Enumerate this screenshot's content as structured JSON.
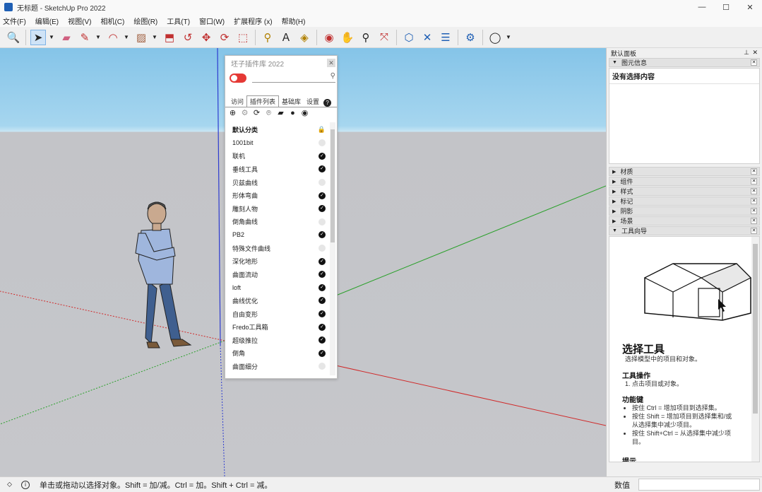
{
  "window": {
    "title": "无标题 - SketchUp Pro 2022",
    "minimize": "—",
    "maximize": "☐",
    "close": "✕"
  },
  "menu": [
    "文件(F)",
    "编辑(E)",
    "视图(V)",
    "相机(C)",
    "绘图(R)",
    "工具(T)",
    "窗口(W)",
    "扩展程序 (x)",
    "帮助(H)"
  ],
  "toolbar_icons": [
    "zoom-extents",
    "select",
    "eraser",
    "pencil-line",
    "arc",
    "paint-bucket",
    "push-pull",
    "follow-me",
    "move",
    "rotate",
    "scale",
    "tape-measure",
    "text",
    "paint",
    "orbit",
    "pan",
    "zoom",
    "zoom-window",
    "warehouse",
    "extension-warehouse",
    "layout",
    "sandbox",
    "account"
  ],
  "plugin_panel": {
    "title": "坯子插件库 2022",
    "search_placeholder": "",
    "tabs": [
      "访问",
      "插件列表",
      "基础库",
      "设置",
      "?"
    ],
    "category": "默认分类",
    "items": [
      {
        "name": "1001bit",
        "enabled": false
      },
      {
        "name": "联机",
        "enabled": true
      },
      {
        "name": "垂线工具",
        "enabled": true
      },
      {
        "name": "贝兹曲线",
        "enabled": false
      },
      {
        "name": "形体弯曲",
        "enabled": true
      },
      {
        "name": "雕刻人物",
        "enabled": true
      },
      {
        "name": "倒角曲线",
        "enabled": false
      },
      {
        "name": "PB2",
        "enabled": true
      },
      {
        "name": "特殊文件曲线",
        "enabled": false
      },
      {
        "name": "深化地形",
        "enabled": true
      },
      {
        "name": "曲面流动",
        "enabled": true
      },
      {
        "name": "loft",
        "enabled": true
      },
      {
        "name": "曲线优化",
        "enabled": true
      },
      {
        "name": "自由变形",
        "enabled": true
      },
      {
        "name": "Fredo工具箱",
        "enabled": true
      },
      {
        "name": "超级推拉",
        "enabled": true
      },
      {
        "name": "倒角",
        "enabled": true
      },
      {
        "name": "曲面细分",
        "enabled": false
      }
    ]
  },
  "tray": {
    "title": "默认面板",
    "entity_info": {
      "header": "图元信息",
      "content": "没有选择内容"
    },
    "sections": [
      "材质",
      "组件",
      "样式",
      "标记",
      "阴影",
      "场景",
      "工具向导"
    ],
    "instructor": {
      "title": "选择工具",
      "desc": "选择模型中的项目和对象。",
      "ops_header": "工具操作",
      "ops_1": "1. 点击项目或对象。",
      "keys_header": "功能键",
      "keys": [
        "按住 Ctrl = 增加项目到选择集。",
        "按住 Shift = 增加项目到选择集和/或从选择集中减少项目。",
        "按住 Shift+Ctrl = 从选择集中减少项目。"
      ],
      "tips_header": "提示"
    }
  },
  "status": {
    "text": "单击或拖动以选择对象。Shift = 加/减。Ctrl = 加。Shift + Ctrl = 减。",
    "measure_label": "数值",
    "measure_value": ""
  }
}
